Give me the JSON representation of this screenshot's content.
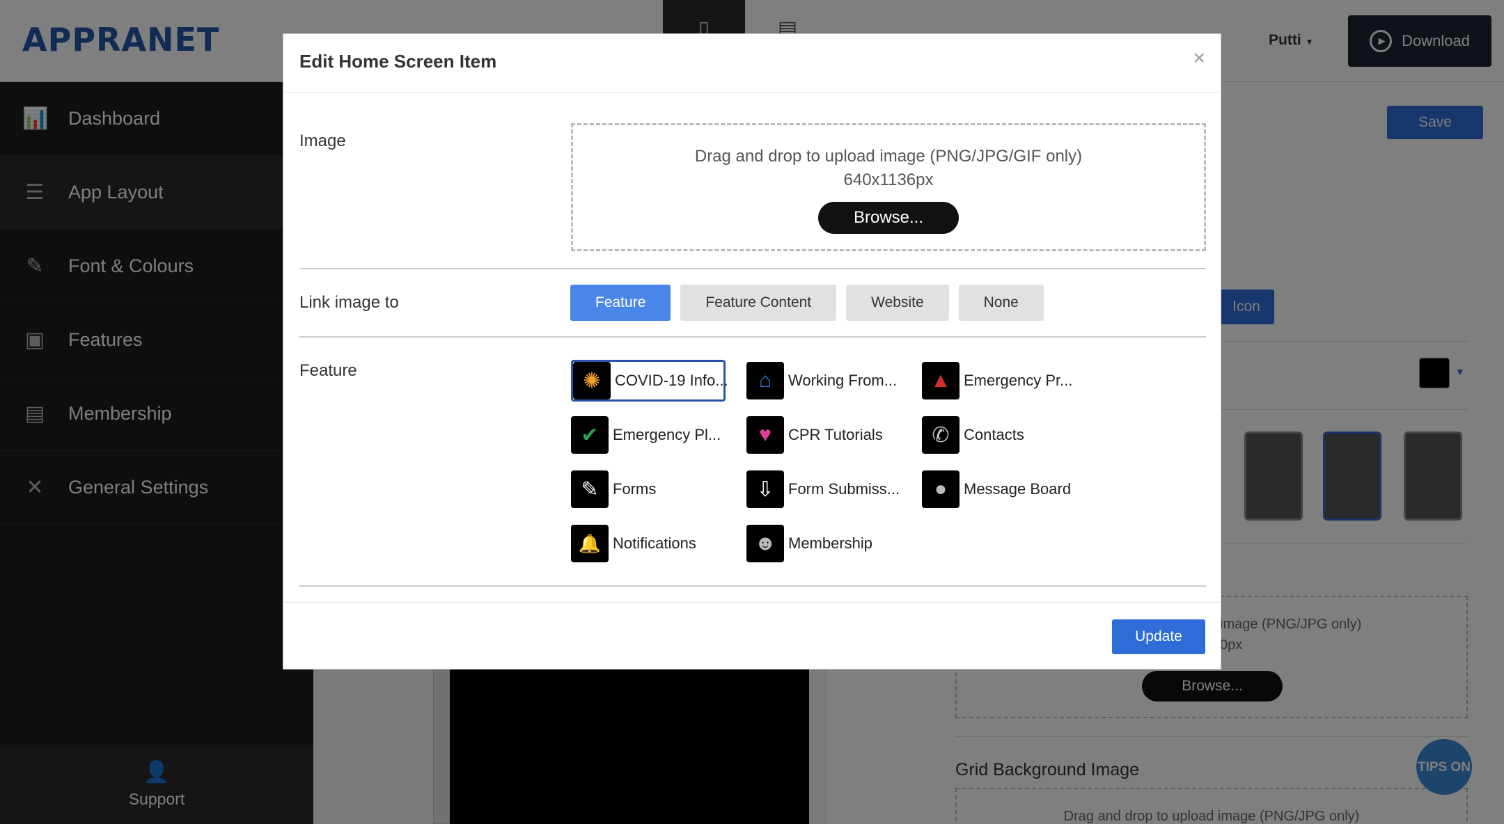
{
  "header": {
    "logo": "APPRANET",
    "user_name": "Putti",
    "download_label": "Download",
    "icons": {
      "phone": "phone-icon",
      "document": "document-icon",
      "play": "play-circle-icon"
    }
  },
  "sidebar": {
    "items": [
      {
        "label": "Dashboard",
        "icon": "bar-chart-icon",
        "glyph": "📊"
      },
      {
        "label": "App Layout",
        "icon": "layout-icon",
        "glyph": "☰"
      },
      {
        "label": "Font & Colours",
        "icon": "pencil-icon",
        "glyph": "✎"
      },
      {
        "label": "Features",
        "icon": "monitor-icon",
        "glyph": "▣"
      },
      {
        "label": "Membership",
        "icon": "id-card-icon",
        "glyph": "▤"
      },
      {
        "label": "General Settings",
        "icon": "tools-icon",
        "glyph": "✕"
      }
    ],
    "support_label": "Support"
  },
  "right_panel": {
    "save_label": "Save",
    "icon_button_label": "Icon",
    "upload_text_line1": "image (PNG/JPG only)",
    "upload_text_line2": "0px",
    "browse_label": "Browse...",
    "grid_bg_label": "Grid Background Image",
    "grid_bg_drop_text": "Drag and drop to upload image (PNG/JPG only)",
    "swatch_color": "#000000",
    "tips_label": "TIPS ON"
  },
  "modal": {
    "title": "Edit Home Screen Item",
    "close_glyph": "×",
    "image_label": "Image",
    "drop_text_line1": "Drag and drop to upload image (PNG/JPG/GIF only)",
    "drop_text_line2": "640x1136px",
    "browse_label": "Browse...",
    "link_label": "Link image to",
    "link_options": [
      {
        "label": "Feature",
        "active": true
      },
      {
        "label": "Feature Content",
        "active": false
      },
      {
        "label": "Website",
        "active": false
      },
      {
        "label": "None",
        "active": false
      }
    ],
    "feature_label": "Feature",
    "features": [
      {
        "label": "COVID-19 Info...",
        "icon": "virus-icon",
        "glyph": "✺",
        "color": "#f0a030",
        "selected": true
      },
      {
        "label": "Working From...",
        "icon": "home-icon",
        "glyph": "⌂",
        "color": "#3a7bd5",
        "selected": false
      },
      {
        "label": "Emergency Pr...",
        "icon": "warning-icon",
        "glyph": "▲",
        "color": "#d32f2f",
        "selected": false
      },
      {
        "label": "Emergency Pl...",
        "icon": "shield-check-icon",
        "glyph": "✔",
        "color": "#2e9e4f",
        "selected": false
      },
      {
        "label": "CPR Tutorials",
        "icon": "heart-icon",
        "glyph": "♥",
        "color": "#e0409a",
        "selected": false
      },
      {
        "label": "Contacts",
        "icon": "phone-icon",
        "glyph": "✆",
        "color": "#cccccc",
        "selected": false
      },
      {
        "label": "Forms",
        "icon": "edit-icon",
        "glyph": "✎",
        "color": "#ffffff",
        "selected": false
      },
      {
        "label": "Form Submiss...",
        "icon": "inbox-icon",
        "glyph": "⇩",
        "color": "#ffffff",
        "selected": false
      },
      {
        "label": "Message Board",
        "icon": "speech-bubble-icon",
        "glyph": "●",
        "color": "#bbbbbb",
        "selected": false
      },
      {
        "label": "Notifications",
        "icon": "bell-icon",
        "glyph": "🔔",
        "color": "#bbbbbb",
        "selected": false
      },
      {
        "label": "Membership",
        "icon": "user-circle-icon",
        "glyph": "☻",
        "color": "#bbbbbb",
        "selected": false
      }
    ],
    "update_label": "Update"
  }
}
